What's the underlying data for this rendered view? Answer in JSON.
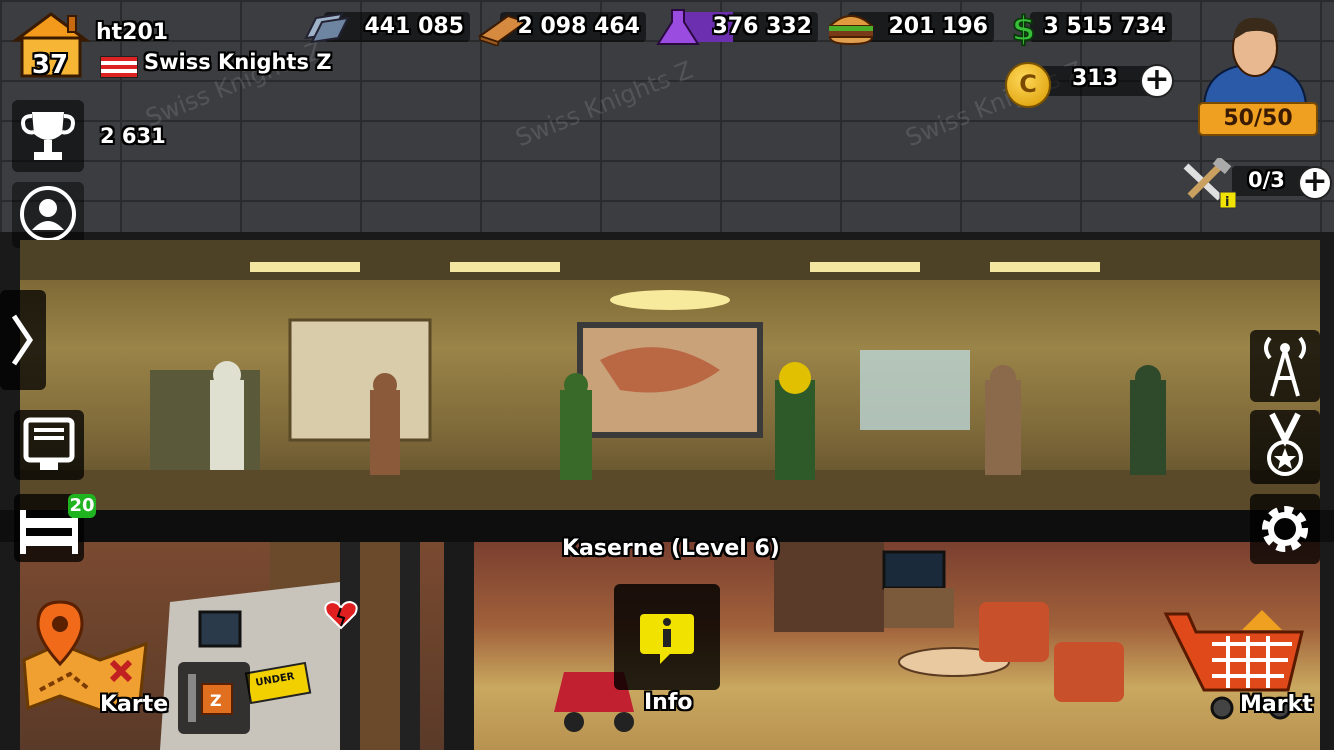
{
  "player": {
    "name": "ht201",
    "level": "37",
    "clan": "Swiss Knights Z"
  },
  "resources": {
    "steel": "441 085",
    "wood": "2 098 464",
    "chemicals": "376 332",
    "food": "201 196",
    "cash": "3 515 734",
    "coins": "313"
  },
  "energy": "50/50",
  "trophies": "2 631",
  "builders": "0/3",
  "barracks_badge": "20",
  "room_title": "Kaserne (Level 6)",
  "buttons": {
    "info": "Info",
    "map": "Karte",
    "market": "Markt"
  },
  "watermark": "Swiss Knights Z",
  "colors": {
    "steel": "#5a8cc8",
    "wood": "#c77a3a",
    "chemicals": "#8a4bd0",
    "cash": "#3abf3a",
    "energy": "#f0a020",
    "info": "#f2e200",
    "badge": "#1fb41f"
  }
}
